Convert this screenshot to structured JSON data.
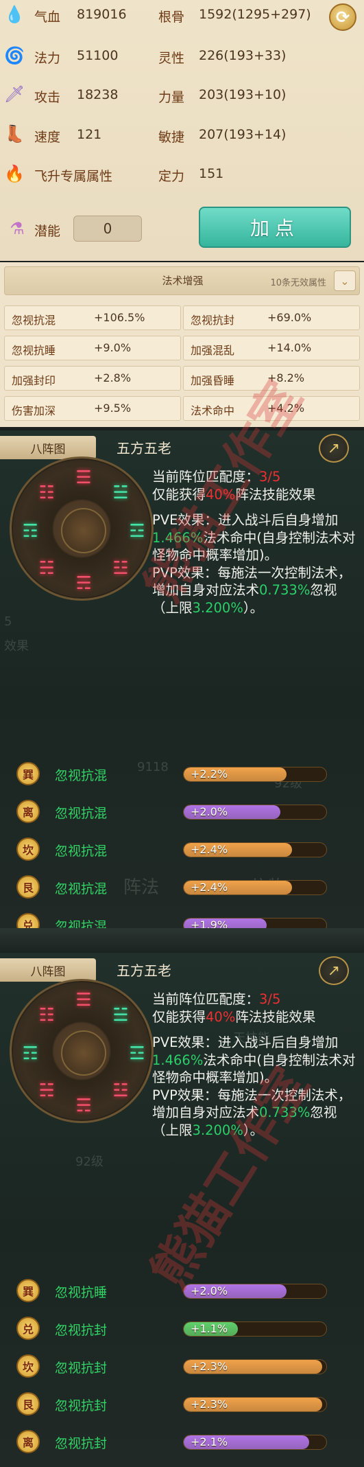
{
  "attributes": {
    "rows": [
      {
        "icon": "blood-drop-icon",
        "label": "气血",
        "value": "819016",
        "label2": "根骨",
        "value2": "1592(1295+297)"
      },
      {
        "icon": "spiral-icon",
        "label": "法力",
        "value": "51100",
        "label2": "灵性",
        "value2": "226(193+33)"
      },
      {
        "icon": "sword-icon",
        "label": "攻击",
        "value": "18238",
        "label2": "力量",
        "value2": "203(193+10)"
      },
      {
        "icon": "boot-icon",
        "label": "速度",
        "value": "121",
        "label2": "敏捷",
        "value2": "207(193+14)"
      }
    ],
    "ascend_label": "飞升专属属性",
    "focus_label": "定力",
    "focus_value": "151",
    "potential_label": "潜能",
    "potential_value": "0",
    "add_points_label": "加点"
  },
  "magic": {
    "title": "法术增强",
    "note": "10条无效属性",
    "cells": [
      {
        "name": "忽视抗混",
        "value": "+106.5%"
      },
      {
        "name": "忽视抗封",
        "value": "+69.0%"
      },
      {
        "name": "忽视抗睡",
        "value": "+9.0%"
      },
      {
        "name": "加强混乱",
        "value": "+14.0%"
      },
      {
        "name": "加强封印",
        "value": "+2.8%"
      },
      {
        "name": "加强昏睡",
        "value": "+8.2%"
      },
      {
        "name": "伤害加深",
        "value": "+9.5%"
      },
      {
        "name": "法术命中",
        "value": "+4.2%"
      }
    ]
  },
  "formations": [
    {
      "tab": "八阵图",
      "name": "五方五老",
      "match_label": "当前阵位匹配度：",
      "match_value": "3/5",
      "partial_a": "仅能获得",
      "partial_pct": "40%",
      "partial_b": "阵法技能效果",
      "pve_a": "PVE效果：进入战斗后自身增加",
      "pve_pct": "1.466%",
      "pve_b": "法术命中(自身控制法术对怪物命中概率增加)。",
      "pvp_a": "PVP效果：每施法一次控制法术，增加自身对应法术",
      "pvp_pct": "0.733%",
      "pvp_b": "忽视（上限",
      "pvp_cap": "3.200%",
      "pvp_c": "）。",
      "rows": [
        {
          "gua": "巽",
          "name": "忽视抗混",
          "bonus": "+2.2%",
          "fill": 0.72,
          "color": "#f0a24a"
        },
        {
          "gua": "离",
          "name": "忽视抗混",
          "bonus": "+2.0%",
          "fill": 0.68,
          "color": "#b074e6"
        },
        {
          "gua": "坎",
          "name": "忽视抗混",
          "bonus": "+2.4%",
          "fill": 0.76,
          "color": "#f0a24a"
        },
        {
          "gua": "艮",
          "name": "忽视抗混",
          "bonus": "+2.4%",
          "fill": 0.76,
          "color": "#f0a24a"
        },
        {
          "gua": "兑",
          "name": "忽视抗混",
          "bonus": "+1.9%",
          "fill": 0.58,
          "color": "#b074e6"
        }
      ],
      "ghost": [
        "5",
        "效果",
        "8",
        "阵法",
        "信物",
        "92级",
        "灵力",
        "9118"
      ]
    },
    {
      "tab": "八阵图",
      "name": "五方五老",
      "match_label": "当前阵位匹配度：",
      "match_value": "3/5",
      "partial_a": "仅能获得",
      "partial_pct": "40%",
      "partial_b": "阵法技能效果",
      "pve_a": "PVE效果：进入战斗后自身增加",
      "pve_pct": "1.466%",
      "pve_b": "法术命中(自身控制法术对怪物命中概率增加)。",
      "pvp_a": "PVP效果：每施法一次控制法术，增加自身对应法术",
      "pvp_pct": "0.733%",
      "pvp_b": "忽视（上限",
      "pvp_cap": "3.200%",
      "pvp_c": "）。",
      "rows": [
        {
          "gua": "巽",
          "name": "忽视抗睡",
          "bonus": "+2.0%",
          "fill": 0.72,
          "color": "#b074e6"
        },
        {
          "gua": "兑",
          "name": "忽视抗封",
          "bonus": "+1.1%",
          "fill": 0.38,
          "color": "#5fcf6b"
        },
        {
          "gua": "坎",
          "name": "忽视抗封",
          "bonus": "+2.3%",
          "fill": 0.97,
          "color": "#f0a24a"
        },
        {
          "gua": "艮",
          "name": "忽视抗封",
          "bonus": "+2.3%",
          "fill": 0.97,
          "color": "#f0a24a"
        },
        {
          "gua": "离",
          "name": "忽视抗封",
          "bonus": "+2.1%",
          "fill": 0.88,
          "color": "#b074e6"
        }
      ],
      "ghost": [
        "天技能",
        "92级"
      ]
    }
  ],
  "watermark": "熊猫工作室",
  "colors": {
    "green": "#2ad06a",
    "red": "#ee2f31",
    "accent": "#36b59d"
  }
}
